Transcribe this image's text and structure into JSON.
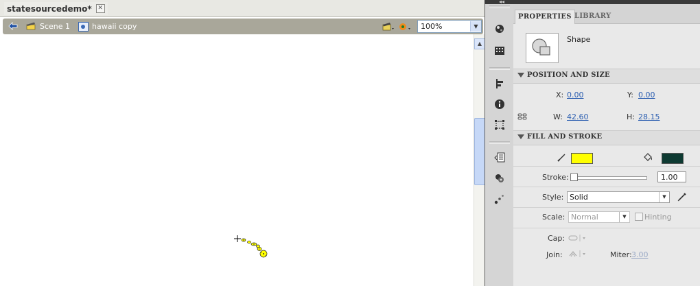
{
  "document": {
    "tab_title": "statesourcedemo*",
    "close_glyph": "✕"
  },
  "edit_bar": {
    "scene_label": "Scene 1",
    "symbol_label": "hawaii copy",
    "zoom_value": "100%"
  },
  "properties_panel": {
    "tabs": [
      "PROPERTIES",
      "LIBRARY"
    ],
    "instance_type": "Shape",
    "position_and_size": {
      "title": "POSITION AND SIZE",
      "x_label": "X:",
      "x_value": "0.00",
      "y_label": "Y:",
      "y_value": "0.00",
      "w_label": "W:",
      "w_value": "42.60",
      "h_label": "H:",
      "h_value": "28.15"
    },
    "fill_and_stroke": {
      "title": "FILL AND STROKE",
      "fill_color": "#ffff00",
      "stroke_color": "#0e3a32",
      "stroke_label": "Stroke:",
      "stroke_value": "1.00",
      "style_label": "Style:",
      "style_value": "Solid",
      "scale_label": "Scale:",
      "scale_value": "Normal",
      "hinting_label": "Hinting",
      "cap_label": "Cap:",
      "join_label": "Join:",
      "miter_label": "Miter:",
      "miter_value": "3.00"
    }
  },
  "tool_dock_icons": [
    "color-wheel-icon",
    "swatches-grid-icon",
    "align-icon",
    "info-icon",
    "transform-icon",
    "code-snippets-icon",
    "components-icon",
    "motion-presets-icon"
  ]
}
